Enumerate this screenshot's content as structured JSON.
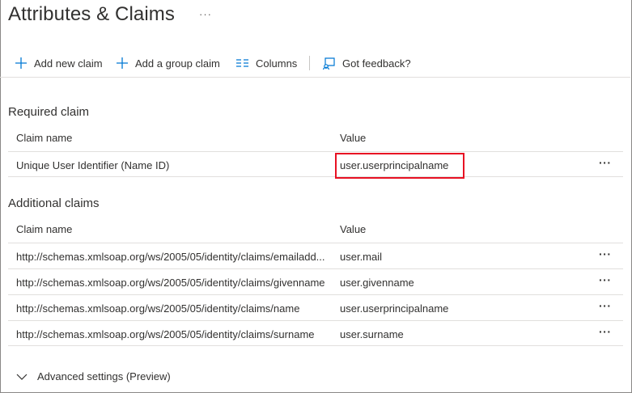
{
  "header": {
    "title": "Attributes & Claims",
    "more": "···"
  },
  "toolbar": {
    "add_new_claim": "Add new claim",
    "add_group_claim": "Add a group claim",
    "columns": "Columns",
    "feedback": "Got feedback?"
  },
  "required": {
    "title": "Required claim",
    "col_name": "Claim name",
    "col_value": "Value",
    "rows": [
      {
        "name": "Unique User Identifier (Name ID)",
        "value": "user.userprincipalname",
        "more": "···"
      }
    ]
  },
  "additional": {
    "title": "Additional claims",
    "col_name": "Claim name",
    "col_value": "Value",
    "rows": [
      {
        "name": "http://schemas.xmlsoap.org/ws/2005/05/identity/claims/emailadd...",
        "value": "user.mail",
        "more": "···"
      },
      {
        "name": "http://schemas.xmlsoap.org/ws/2005/05/identity/claims/givenname",
        "value": "user.givenname",
        "more": "···"
      },
      {
        "name": "http://schemas.xmlsoap.org/ws/2005/05/identity/claims/name",
        "value": "user.userprincipalname",
        "more": "···"
      },
      {
        "name": "http://schemas.xmlsoap.org/ws/2005/05/identity/claims/surname",
        "value": "user.surname",
        "more": "···"
      }
    ]
  },
  "advanced": {
    "label": "Advanced settings (Preview)"
  },
  "colors": {
    "accent": "#0078d4",
    "highlight": "#e81123",
    "text": "#323130",
    "divider": "#e1dfdd"
  }
}
